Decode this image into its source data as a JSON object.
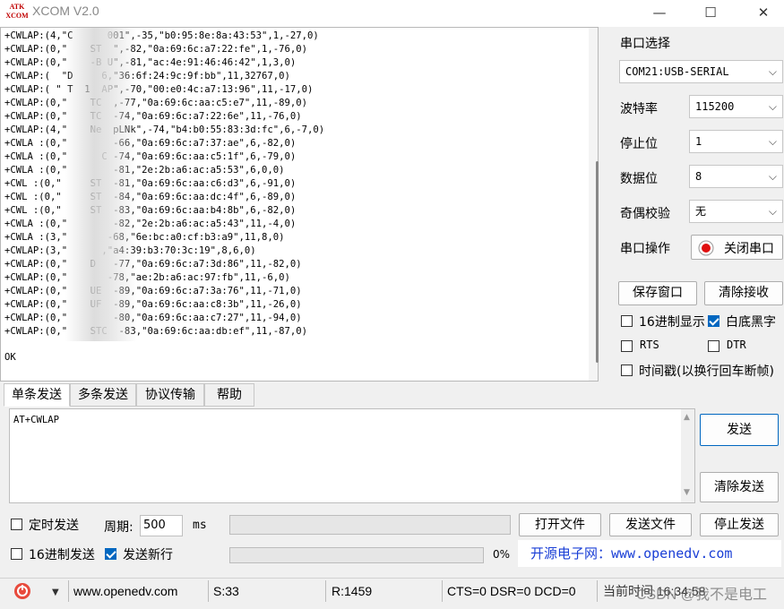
{
  "window": {
    "logo_text": "ATK XCOM",
    "title": "XCOM V2.0",
    "minimize_glyph": "—",
    "maximize_glyph": "☐",
    "close_glyph": "✕"
  },
  "receive": {
    "lines": [
      "+CWLAP:(4,\"C      001\",-35,\"b0:95:8e:8a:43:53\",1,-27,0)",
      "+CWLAP:(0,\"    ST  \",-82,\"0a:69:6c:a7:22:fe\",1,-76,0)",
      "+CWLAP:(0,\"    -B U\",-81,\"ac:4e:91:46:46:42\",1,3,0)",
      "+CWLAP:(  \"D     6,\"36:6f:24:9c:9f:bb\",11,32767,0)",
      "+CWLAP:( \" T  1  AP\",-70,\"00:e0:4c:a7:13:96\",11,-17,0)",
      "+CWLAP:(0,\"    TC  ,-77,\"0a:69:6c:aa:c5:e7\",11,-89,0)",
      "+CWLAP:(0,\"    TC  -74,\"0a:69:6c:a7:22:6e\",11,-76,0)",
      "+CWLAP:(4,\"    Ne  pLNk\",-74,\"b4:b0:55:83:3d:fc\",6,-7,0)",
      "+CWLA :(0,\"        -66,\"0a:69:6c:a7:37:ae\",6,-82,0)",
      "+CWLA :(0,\"      C -74,\"0a:69:6c:aa:c5:1f\",6,-79,0)",
      "+CWLA :(0,\"        -81,\"2e:2b:a6:ac:a5:53\",6,0,0)",
      "+CWL :(0,\"     ST  -81,\"0a:69:6c:aa:c6:d3\",6,-91,0)",
      "+CWL :(0,\"     ST  -84,\"0a:69:6c:aa:dc:4f\",6,-89,0)",
      "+CWL :(0,\"     ST  -83,\"0a:69:6c:aa:b4:8b\",6,-82,0)",
      "+CWLA :(0,\"        -82,\"2e:2b:a6:ac:a5:43\",11,-4,0)",
      "+CWLA :(3,\"       -68,\"6e:bc:a0:cf:b3:a9\",11,8,0)",
      "+CWLAP:(3,\"      ,\"a4:39:b3:70:3c:19\",8,6,0)",
      "+CWLAP:(0,\"    D   -77,\"0a:69:6c:a7:3d:86\",11,-82,0)",
      "+CWLAP:(0,\"       -78,\"ae:2b:a6:ac:97:fb\",11,-6,0)",
      "+CWLAP:(0,\"    UE  -89,\"0a:69:6c:a7:3a:76\",11,-71,0)",
      "+CWLAP:(0,\"    UF  -89,\"0a:69:6c:aa:c8:3b\",11,-26,0)",
      "+CWLAP:(0,\"        -80,\"0a:69:6c:aa:c7:27\",11,-94,0)",
      "+CWLAP:(0,\"    STC  -83,\"0a:69:6c:aa:db:ef\",11,-87,0)"
    ],
    "ok": "OK"
  },
  "panel": {
    "port_label": "串口选择",
    "port_value": "COM21:USB-SERIAL",
    "baud_label": "波特率",
    "baud_value": "115200",
    "stop_label": "停止位",
    "stop_value": "1",
    "data_label": "数据位",
    "data_value": "8",
    "parity_label": "奇偶校验",
    "parity_value": "无",
    "op_label": "串口操作",
    "close_port": "关闭串口",
    "save_window": "保存窗口",
    "clear_receive": "清除接收",
    "hex_display": "16进制显示",
    "white_black": "白底黑字",
    "rts": "RTS",
    "dtr": "DTR",
    "timestamp": "时间戳(以换行回车断帧)"
  },
  "tabs": [
    "单条发送",
    "多条发送",
    "协议传输",
    "帮助"
  ],
  "send": {
    "text": "AT+CWLAP",
    "send_button": "发送",
    "clear_send_button": "清除发送"
  },
  "options": {
    "timed_send": "定时发送",
    "period_label": "周期:",
    "period_value": "500",
    "period_unit": "ms",
    "open_file": "打开文件",
    "send_file": "发送文件",
    "stop_send": "停止发送",
    "hex_send": "16进制发送",
    "send_newline": "发送新行",
    "progress_text": "0%",
    "progress": 0,
    "ad_text": "开源电子网：www.openedv.com"
  },
  "status": {
    "url": "www.openedv.com",
    "sent": "S:33",
    "received": "R:1459",
    "lines": "CTS=0 DSR=0 DCD=0",
    "time": "当前时间 16:34:58",
    "watermark": "CSDN @我不是电工"
  },
  "colors": {
    "accent": "#0067c0",
    "ad_blue": "#1a3fd6",
    "record_red": "#e01010"
  }
}
